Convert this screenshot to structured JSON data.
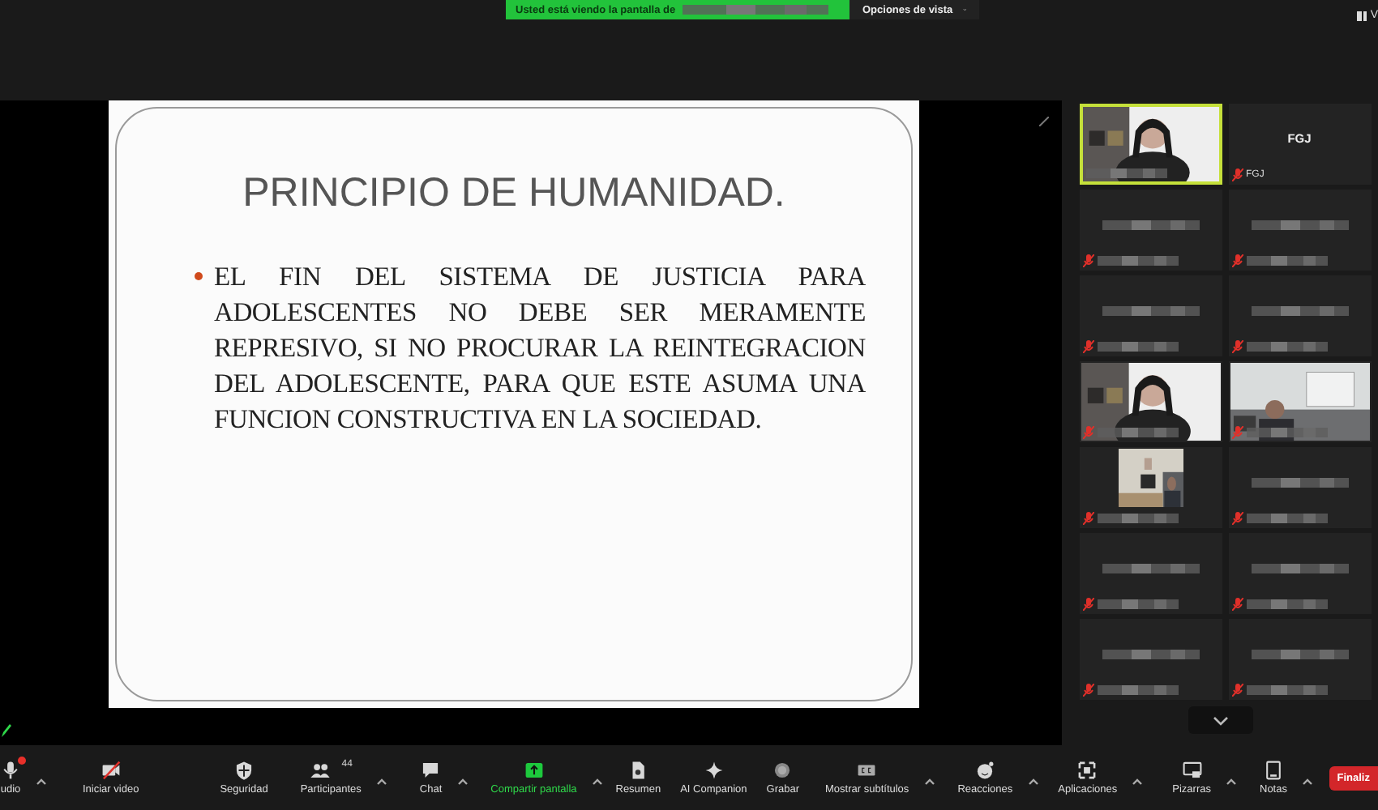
{
  "top_bar": {
    "banner": "Usted está viendo la pantalla de",
    "view_options": "Opciones de vista",
    "corner": "V"
  },
  "slide": {
    "title": "PRINCIPIO DE HUMANIDAD.",
    "bullets": [
      "EL FIN DEL SISTEMA DE JUSTICIA PARA ADOLESCENTES NO DEBE SER MERAMENTE REPRESIVO, SI NO PROCURAR LA REINTEGRACION DEL ADOLESCENTE, PARA QUE ESTE ASUMA UNA FUNCION CONSTRUCTIVA EN LA SOCIEDAD."
    ]
  },
  "participants": [
    {
      "kind": "video",
      "speaking": true,
      "muted": false
    },
    {
      "kind": "name",
      "name": "FGJ",
      "label": "FGJ",
      "speaking": false,
      "muted": true
    },
    {
      "kind": "hidden",
      "speaking": false,
      "muted": true
    },
    {
      "kind": "hidden",
      "speaking": false,
      "muted": true
    },
    {
      "kind": "hidden",
      "speaking": false,
      "muted": true
    },
    {
      "kind": "hidden",
      "speaking": false,
      "muted": true
    },
    {
      "kind": "video",
      "speaking": false,
      "muted": true
    },
    {
      "kind": "video",
      "speaking": false,
      "muted": true
    },
    {
      "kind": "video_small",
      "speaking": false,
      "muted": true
    },
    {
      "kind": "hidden",
      "speaking": false,
      "muted": true
    },
    {
      "kind": "hidden",
      "speaking": false,
      "muted": true
    },
    {
      "kind": "hidden",
      "speaking": false,
      "muted": true
    },
    {
      "kind": "hidden",
      "speaking": false,
      "muted": true
    },
    {
      "kind": "hidden",
      "speaking": false,
      "muted": true
    }
  ],
  "toolbar": [
    {
      "label": "udio",
      "kind": "mic",
      "caret": true,
      "alert": true
    },
    {
      "label": "Iniciar video",
      "kind": "video_off",
      "caret": false,
      "alert": false
    },
    {
      "label": "Seguridad",
      "kind": "shield",
      "caret": false,
      "alert": false
    },
    {
      "label": "Participantes",
      "kind": "people",
      "caret": true,
      "alert": false,
      "count": "44"
    },
    {
      "label": "Chat",
      "kind": "chat",
      "caret": true,
      "alert": false
    },
    {
      "label": "Compartir pantalla",
      "kind": "share",
      "caret": true,
      "alert": false
    },
    {
      "label": "Resumen",
      "kind": "doc",
      "caret": false,
      "alert": false
    },
    {
      "label": "AI Companion",
      "kind": "sparkle",
      "caret": false,
      "alert": false
    },
    {
      "label": "Grabar",
      "kind": "record",
      "caret": false,
      "alert": false
    },
    {
      "label": "Mostrar subtítulos",
      "kind": "cc",
      "caret": true,
      "alert": false
    },
    {
      "label": "Reacciones",
      "kind": "smile",
      "caret": true,
      "alert": false
    },
    {
      "label": "Aplicaciones",
      "kind": "apps",
      "caret": true,
      "alert": false
    },
    {
      "label": "Pizarras",
      "kind": "board",
      "caret": true,
      "alert": false
    },
    {
      "label": "Notas",
      "kind": "notes",
      "caret": true,
      "alert": false
    }
  ],
  "end_button": "Finaliz"
}
